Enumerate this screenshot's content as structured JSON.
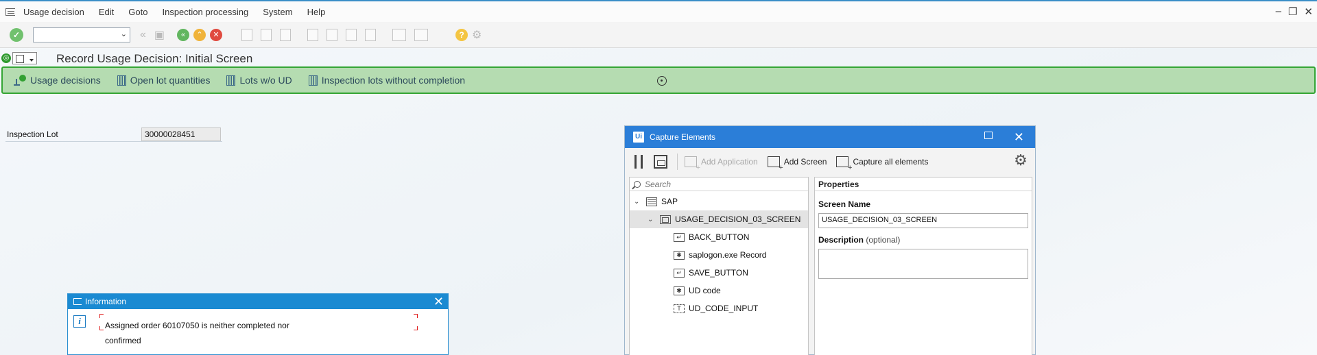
{
  "menubar": {
    "items": [
      "Usage decision",
      "Edit",
      "Goto",
      "Inspection processing",
      "System",
      "Help"
    ]
  },
  "toolbar": {
    "command_field_value": ""
  },
  "screen": {
    "title": "Record Usage Decision: Initial Screen"
  },
  "app_toolbar": {
    "usage_decisions": "Usage decisions",
    "open_lot_quantities": "Open lot quantities",
    "lots_wo_ud": "Lots w/o UD",
    "lots_without_completion": "Inspection lots without completion"
  },
  "form": {
    "inspection_lot_label": "Inspection Lot",
    "inspection_lot_value": "30000028451"
  },
  "info_popup": {
    "title": "Information",
    "message": "Assigned order 60107050 is neither completed nor confirmed"
  },
  "capture": {
    "title": "Capture Elements",
    "logo_text": "Ui",
    "add_application": "Add Application",
    "add_screen": "Add Screen",
    "capture_all": "Capture all elements",
    "search_placeholder": "Search",
    "tree": {
      "root": "SAP",
      "screen": "USAGE_DECISION_03_SCREEN",
      "elements": [
        "BACK_BUTTON",
        "saplogon.exe Record",
        "SAVE_BUTTON",
        "UD code",
        "UD_CODE_INPUT"
      ]
    },
    "properties": {
      "header": "Properties",
      "screen_name_label": "Screen Name",
      "screen_name_value": "USAGE_DECISION_03_SCREEN",
      "description_label": "Description",
      "description_optional": "(optional)",
      "description_value": ""
    }
  },
  "colors": {
    "sap_green_toolbar": "#b5dcb1",
    "sap_green_border": "#34a534",
    "uipath_blue": "#2b7ed8",
    "info_blue": "#1a8ad2"
  }
}
